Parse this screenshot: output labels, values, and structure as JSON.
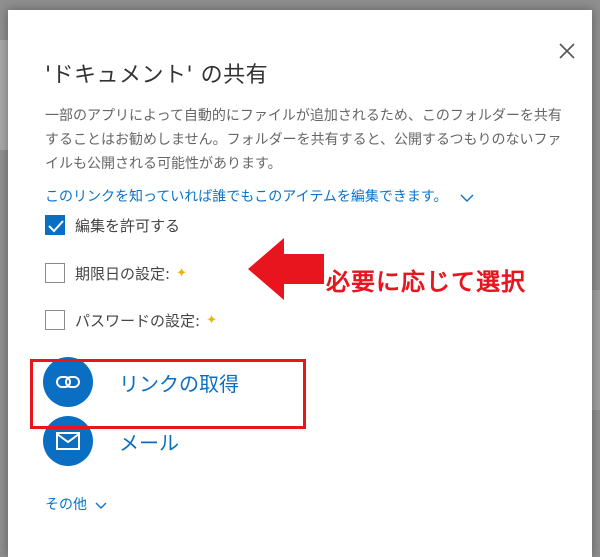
{
  "dialog": {
    "title": "'ドキュメント' の共有",
    "description": "一部のアプリによって自動的にファイルが追加されるため、このフォルダーを共有することはお勧めしません。フォルダーを共有すると、公開するつもりのないファイルも公開される可能性があります。",
    "link_setting": "このリンクを知っていれば誰でもこのアイテムを編集できます。",
    "options": [
      {
        "label": "編集を許可する",
        "checked": true
      },
      {
        "label": "期限日の設定:",
        "checked": false
      },
      {
        "label": "パスワードの設定:",
        "checked": false
      }
    ],
    "actions": {
      "get_link": "リンクの取得",
      "mail": "メール"
    },
    "more": "その他"
  },
  "annotation": {
    "note": "必要に応じて選択",
    "color": "#e8141e"
  },
  "colors": {
    "accent": "#0a6fc2",
    "premium_star": "#f0b400"
  },
  "icons": [
    "close-icon",
    "chevron-down-icon",
    "checkmark-icon",
    "premium-star-icon",
    "link-icon",
    "mail-icon",
    "arrow-left-icon"
  ]
}
